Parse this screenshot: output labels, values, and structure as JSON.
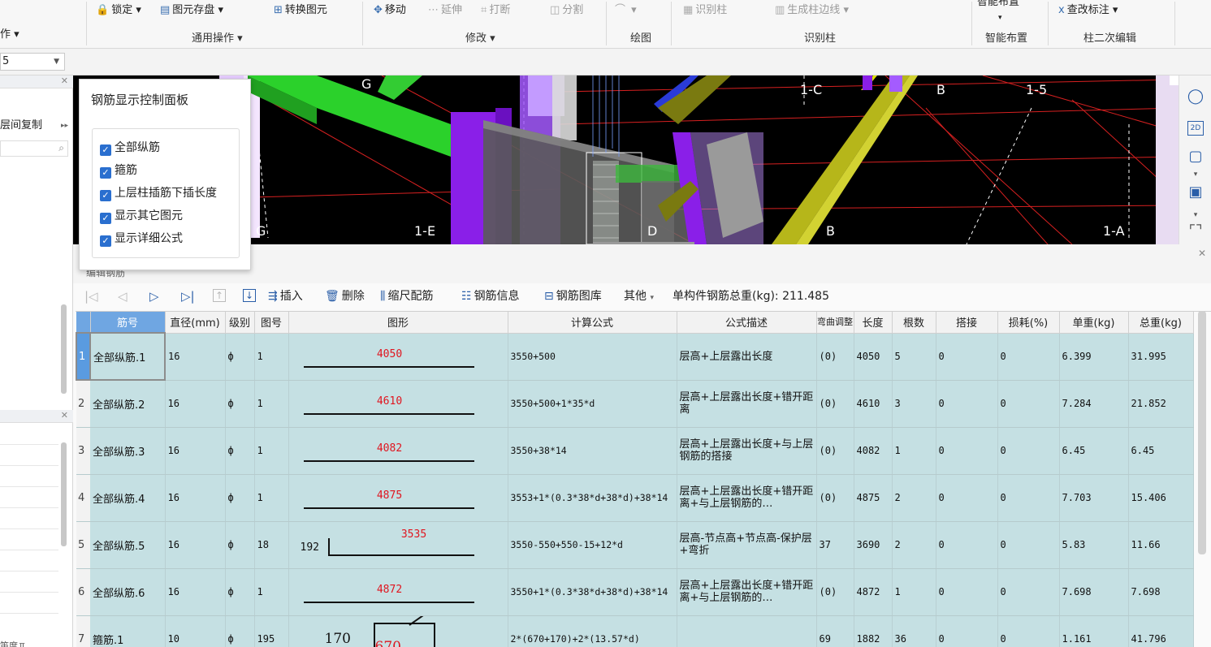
{
  "ribbon": {
    "row1": [
      {
        "id": "lock",
        "icon": "lock-icon",
        "glyph": "🔒",
        "label": "锁定",
        "dropdown": true,
        "enabled": true
      },
      {
        "id": "save-element",
        "icon": "save-element-icon",
        "glyph": "▤",
        "label": "图元存盘",
        "dropdown": true,
        "enabled": true
      },
      {
        "id": "convert",
        "icon": "convert-element-icon",
        "glyph": "⊞",
        "label": "转换图元",
        "dropdown": false,
        "enabled": true
      },
      {
        "id": "move",
        "icon": "move-icon",
        "glyph": "✥",
        "label": "移动",
        "dropdown": false,
        "enabled": true
      },
      {
        "id": "extend",
        "icon": "extend-icon",
        "glyph": "⋯",
        "label": "延伸",
        "dropdown": false,
        "enabled": false
      },
      {
        "id": "break",
        "icon": "break-icon",
        "glyph": "⌗",
        "label": "打断",
        "dropdown": false,
        "enabled": false
      },
      {
        "id": "split",
        "icon": "split-icon",
        "glyph": "◫",
        "label": "分割",
        "dropdown": false,
        "enabled": false
      },
      {
        "id": "draw",
        "icon": "draw-arc-icon",
        "glyph": "⌒",
        "label": "",
        "dropdown": true,
        "enabled": false
      },
      {
        "id": "identify-col",
        "icon": "identify-column-icon",
        "glyph": "▦",
        "label": "识别柱",
        "dropdown": false,
        "enabled": false
      },
      {
        "id": "gen-edge",
        "icon": "generate-edge-icon",
        "glyph": "▥",
        "label": "生成柱边线",
        "dropdown": true,
        "enabled": false
      },
      {
        "id": "check-annot",
        "icon": "check-annotation-icon",
        "glyph": "ⅹ",
        "label": "查改标注",
        "dropdown": true,
        "enabled": true
      }
    ],
    "smart_top": "智能布置",
    "groups": {
      "left_cut": "作",
      "general": "通用操作",
      "modify": "修改",
      "draw": "绘图",
      "identify": "识别柱",
      "smart": "智能布置",
      "column_edit": "柱二次编辑"
    }
  },
  "subbar": {
    "floor_value": "5"
  },
  "leftpanel": {
    "copy_label": "层间复制",
    "bottom_text": "笛度ㅍ"
  },
  "viewport": {
    "axis_labels": {
      "a": "1-C",
      "b": "1-5",
      "c": "1-E",
      "d": "1-A",
      "e": "G",
      "f": "G",
      "g": "B",
      "h": "B",
      "i": "D"
    }
  },
  "control_panel": {
    "title": "钢筋显示控制面板",
    "options": [
      {
        "label": "全部纵筋",
        "checked": true
      },
      {
        "label": "箍筋",
        "checked": true
      },
      {
        "label": "上层柱插筋下插长度",
        "checked": true
      },
      {
        "label": "显示其它图元",
        "checked": true
      },
      {
        "label": "显示详细公式",
        "checked": true
      }
    ]
  },
  "editor": {
    "title": "编辑钢筋",
    "toolbar": {
      "insert": "插入",
      "delete": "删除",
      "scale": "缩尺配筋",
      "info": "钢筋信息",
      "library": "钢筋图库",
      "other": "其他",
      "weight_label": "单构件钢筋总重(kg):",
      "weight_value": "211.485"
    },
    "columns": [
      "筋号",
      "直径(mm)",
      "级别",
      "图号",
      "图形",
      "计算公式",
      "公式描述",
      "弯曲调整",
      "长度",
      "根数",
      "搭接",
      "损耗(%)",
      "单重(kg)",
      "总重(kg)"
    ],
    "rows": [
      {
        "no": "1",
        "name": "全部纵筋.1",
        "dia": "16",
        "grade": "ф",
        "fig": "1",
        "shape_val": "4050",
        "formula": "3550+500",
        "desc": "层高+上层露出长度",
        "bend": "(0)",
        "len": "4050",
        "count": "5",
        "lap": "0",
        "loss": "0",
        "unit": "6.399",
        "total": "31.995"
      },
      {
        "no": "2",
        "name": "全部纵筋.2",
        "dia": "16",
        "grade": "ф",
        "fig": "1",
        "shape_val": "4610",
        "formula": "3550+500+1*35*d",
        "desc": "层高+上层露出长度+错开距离",
        "bend": "(0)",
        "len": "4610",
        "count": "3",
        "lap": "0",
        "loss": "0",
        "unit": "7.284",
        "total": "21.852"
      },
      {
        "no": "3",
        "name": "全部纵筋.3",
        "dia": "16",
        "grade": "ф",
        "fig": "1",
        "shape_val": "4082",
        "formula": "3550+38*14",
        "desc": "层高+上层露出长度+与上层钢筋的搭接",
        "bend": "(0)",
        "len": "4082",
        "count": "1",
        "lap": "0",
        "loss": "0",
        "unit": "6.45",
        "total": "6.45"
      },
      {
        "no": "4",
        "name": "全部纵筋.4",
        "dia": "16",
        "grade": "ф",
        "fig": "1",
        "shape_val": "4875",
        "formula": "3553+1*(0.3*38*d+38*d)+38*14",
        "desc": "层高+上层露出长度+错开距离+与上层钢筋的…",
        "bend": "(0)",
        "len": "4875",
        "count": "2",
        "lap": "0",
        "loss": "0",
        "unit": "7.703",
        "total": "15.406"
      },
      {
        "no": "5",
        "name": "全部纵筋.5",
        "dia": "16",
        "grade": "ф",
        "fig": "18",
        "shape_val": "3535",
        "shape_side": "192",
        "formula": "3550-550+550-15+12*d",
        "desc": "层高-节点高+节点高-保护层+弯折",
        "bend": "37",
        "len": "3690",
        "count": "2",
        "lap": "0",
        "loss": "0",
        "unit": "5.83",
        "total": "11.66"
      },
      {
        "no": "6",
        "name": "全部纵筋.6",
        "dia": "16",
        "grade": "ф",
        "fig": "1",
        "shape_val": "4872",
        "formula": "3550+1*(0.3*38*d+38*d)+38*14",
        "desc": "层高+上层露出长度+错开距离+与上层钢筋的…",
        "bend": "(0)",
        "len": "4872",
        "count": "1",
        "lap": "0",
        "loss": "0",
        "unit": "7.698",
        "total": "7.698"
      },
      {
        "no": "7",
        "name": "箍筋.1",
        "dia": "10",
        "grade": "ф",
        "fig": "195",
        "shape_val": "670",
        "shape_side": "170",
        "formula": "2*(670+170)+2*(13.57*d)",
        "desc": "",
        "bend": "69",
        "len": "1882",
        "count": "36",
        "lap": "0",
        "loss": "0",
        "unit": "1.161",
        "total": "41.796"
      }
    ]
  }
}
